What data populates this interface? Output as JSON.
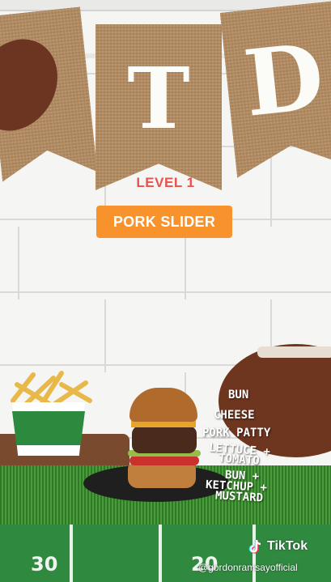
{
  "banner": {
    "letters": [
      "T",
      "D"
    ]
  },
  "overlay": {
    "level": "LEVEL 1",
    "title": "PORK SLIDER"
  },
  "ingredients": [
    "BUN",
    "CHEESE",
    "PORK PATTY",
    "LETTUCE +",
    "TOMATO",
    "BUN +",
    "KETCHUP +",
    "MUSTARD"
  ],
  "field": {
    "yard_numbers": [
      "30",
      "20"
    ]
  },
  "watermark": {
    "brand": "TikTok",
    "handle": "@gordonramsayofficial",
    "icon": "tiktok-icon"
  },
  "colors": {
    "level_text": "#e8524f",
    "title_badge": "#f7922d",
    "turf": "#3d8a2f"
  }
}
